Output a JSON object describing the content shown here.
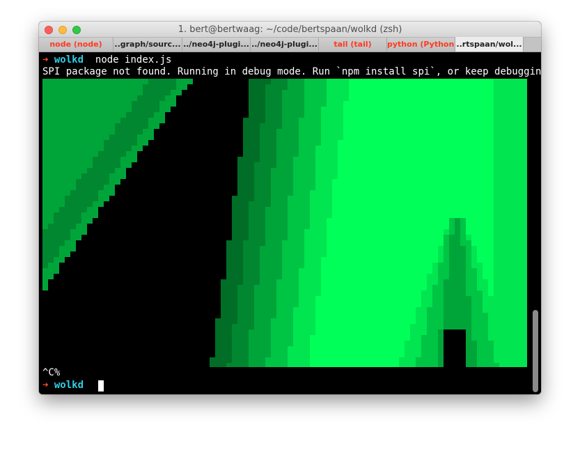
{
  "window": {
    "title": "1. bert@bertwaag: ~/code/bertspaan/wolkd (zsh)"
  },
  "tabs": [
    {
      "label": "node (node)",
      "color": "#ff3b1f"
    },
    {
      "label": "..graph/sourc...",
      "color": "#222222"
    },
    {
      "label": "../neo4j-plugi...",
      "color": "#222222"
    },
    {
      "label": "../neo4j-plugi...",
      "color": "#222222"
    },
    {
      "label": "tail (tail)",
      "color": "#ff3b1f"
    },
    {
      "label": "python (Python)",
      "color": "#ff3b1f"
    },
    {
      "label": "..rtspaan/wol...",
      "color": "#222222",
      "active": true
    }
  ],
  "terminal": {
    "prompt_arrow": "➜",
    "prompt_dir": "wolkd",
    "command": "node index.js",
    "output": "SPI package not found. Running in debug mode. Run `npm install spi`, or keep debugging!",
    "interrupt": "^C%",
    "prompt2_arrow": "➜",
    "prompt2_dir": "wolkd"
  },
  "colors": {
    "greens": [
      "#00ff59",
      "#00e550",
      "#00c444",
      "#00a53a",
      "#00872f",
      "#006e26"
    ],
    "background": "#000000"
  }
}
